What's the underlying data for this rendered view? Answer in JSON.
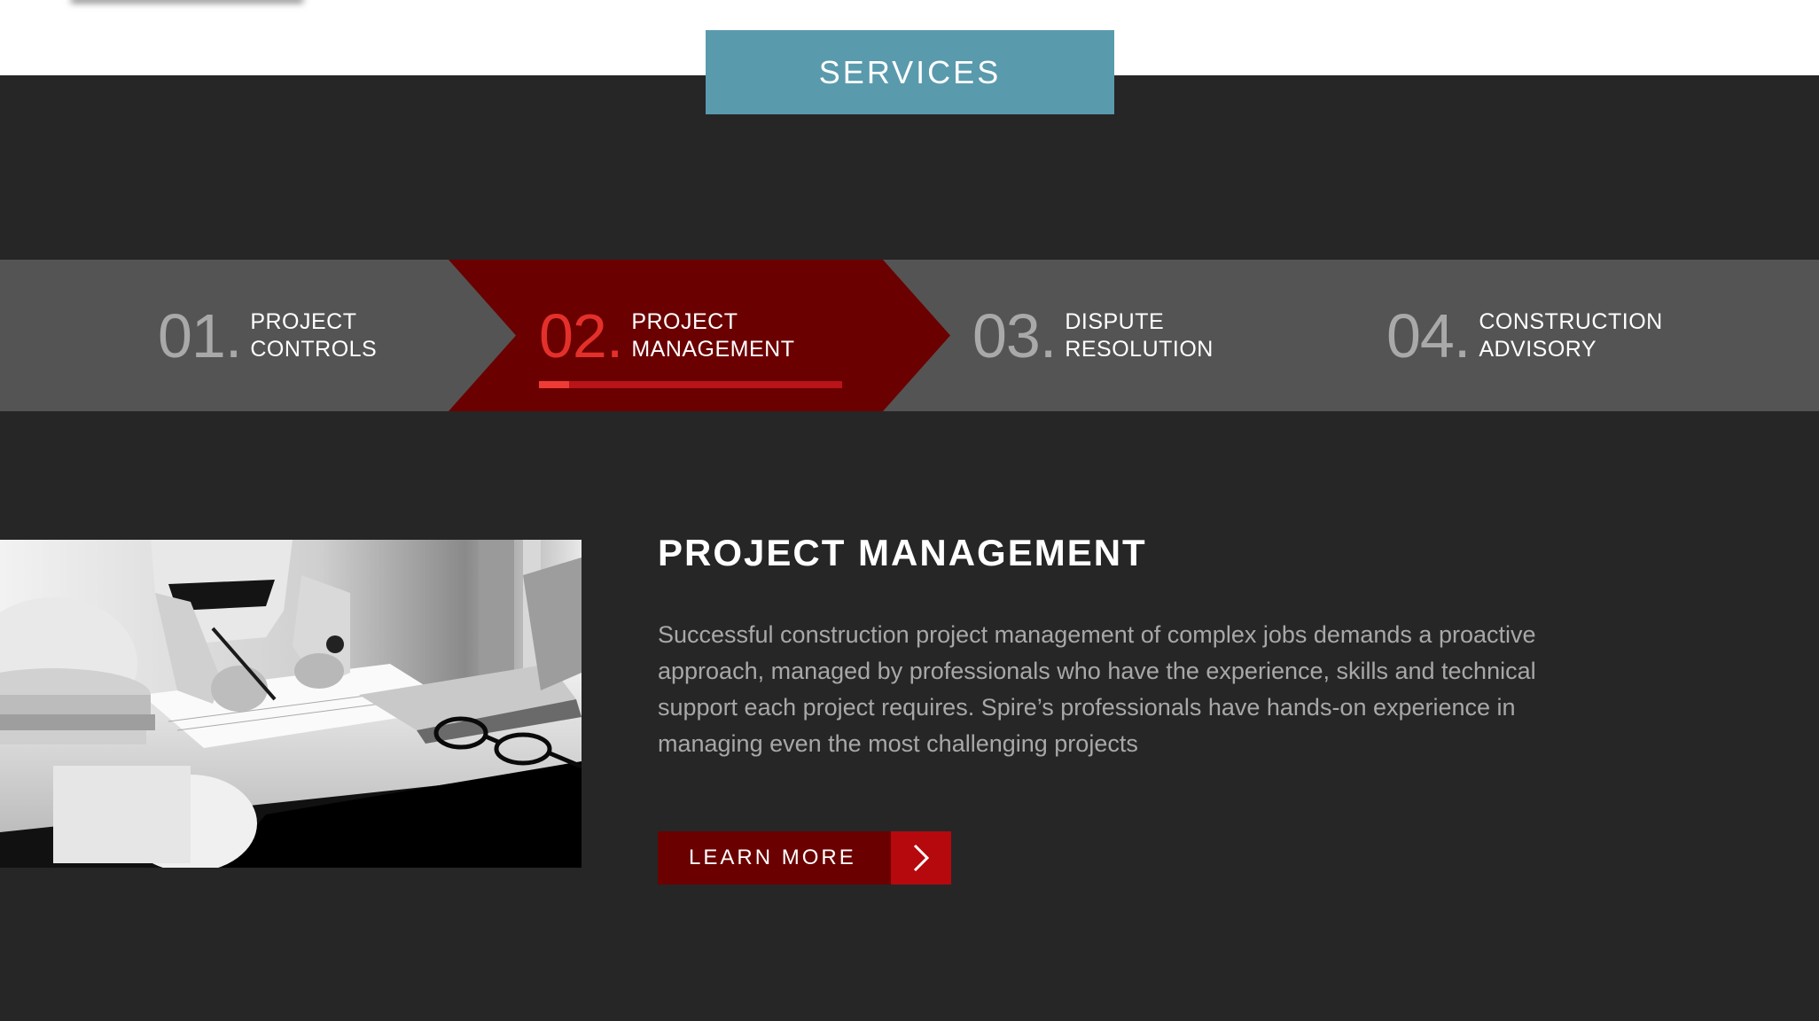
{
  "header": {
    "services_label": "SERVICES"
  },
  "tabs": [
    {
      "number": "01",
      "dot": ".",
      "line1": "PROJECT",
      "line2": "CONTROLS",
      "active": false
    },
    {
      "number": "02",
      "dot": ".",
      "line1": "PROJECT",
      "line2": "MANAGEMENT",
      "active": true
    },
    {
      "number": "03",
      "dot": ".",
      "line1": "DISPUTE",
      "line2": "RESOLUTION",
      "active": false
    },
    {
      "number": "04",
      "dot": ".",
      "line1": "CONSTRUCTION",
      "line2": "ADVISORY",
      "active": false
    }
  ],
  "active_tab_progress": 0.1,
  "content": {
    "title": "PROJECT MANAGEMENT",
    "description": "Successful construction project management of complex jobs demands a proactive approach, managed by professionals who have the experience, skills and technical support each project requires. Spire’s professionals have hands-on experience in managing even the most challenging projects",
    "cta_label": "LEARN MORE",
    "cta_icon": "chevron-right-icon"
  },
  "colors": {
    "badge": "#5a9aad",
    "active_tab": "#6b0000",
    "accent_red": "#e4302b",
    "background": "#262627",
    "tab_band": "#545454"
  }
}
